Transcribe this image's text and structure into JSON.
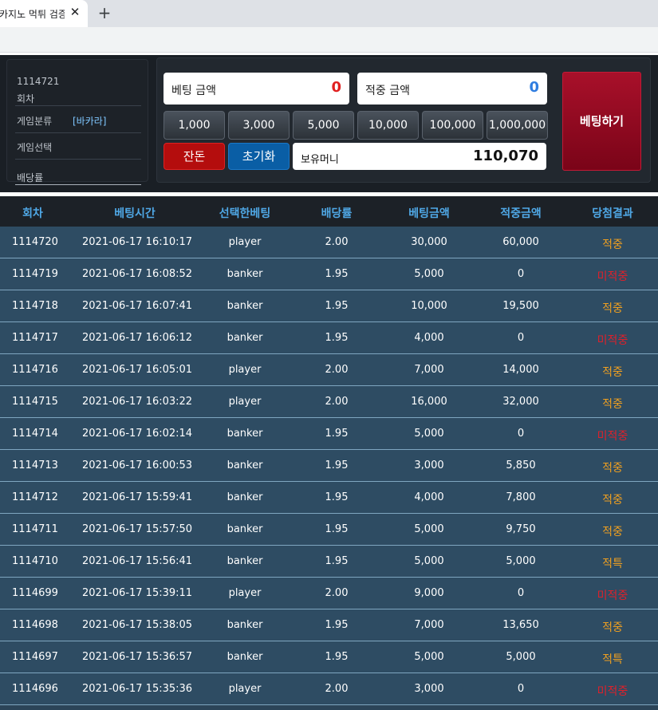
{
  "browser": {
    "tab_title": "카지노 먹튀 검증",
    "close_glyph": "✕",
    "new_tab_glyph": "+"
  },
  "info": {
    "round_number": "1114721",
    "round_label": "회차",
    "category_label": "게임분류",
    "category_value": "[바카라]",
    "select_label": "게임선택",
    "rate_label": "배당률"
  },
  "bet": {
    "bet_amount_label": "베팅 금액",
    "bet_amount_value": "0",
    "win_amount_label": "적중 금액",
    "win_amount_value": "0",
    "chips": [
      "1,000",
      "3,000",
      "5,000",
      "10,000",
      "100,000",
      "1,000,000"
    ],
    "allin_label": "잔돈",
    "reset_label": "초기화",
    "balance_label": "보유머니",
    "balance_value": "110,070",
    "bet_button_label": "베팅하기"
  },
  "table": {
    "headers": [
      "회차",
      "베팅시간",
      "선택한베팅",
      "배당률",
      "베팅금액",
      "적중금액",
      "당첨결과"
    ],
    "rows": [
      {
        "id": "1114720",
        "time": "2021-06-17 16:10:17",
        "pick": "player",
        "rate": "2.00",
        "bet": "30,000",
        "win": "60,000",
        "result": "적중",
        "status": "hit"
      },
      {
        "id": "1114719",
        "time": "2021-06-17 16:08:52",
        "pick": "banker",
        "rate": "1.95",
        "bet": "5,000",
        "win": "0",
        "result": "미적중",
        "status": "miss"
      },
      {
        "id": "1114718",
        "time": "2021-06-17 16:07:41",
        "pick": "banker",
        "rate": "1.95",
        "bet": "10,000",
        "win": "19,500",
        "result": "적중",
        "status": "hit"
      },
      {
        "id": "1114717",
        "time": "2021-06-17 16:06:12",
        "pick": "banker",
        "rate": "1.95",
        "bet": "4,000",
        "win": "0",
        "result": "미적중",
        "status": "miss"
      },
      {
        "id": "1114716",
        "time": "2021-06-17 16:05:01",
        "pick": "player",
        "rate": "2.00",
        "bet": "7,000",
        "win": "14,000",
        "result": "적중",
        "status": "hit"
      },
      {
        "id": "1114715",
        "time": "2021-06-17 16:03:22",
        "pick": "player",
        "rate": "2.00",
        "bet": "16,000",
        "win": "32,000",
        "result": "적중",
        "status": "hit"
      },
      {
        "id": "1114714",
        "time": "2021-06-17 16:02:14",
        "pick": "banker",
        "rate": "1.95",
        "bet": "5,000",
        "win": "0",
        "result": "미적중",
        "status": "miss"
      },
      {
        "id": "1114713",
        "time": "2021-06-17 16:00:53",
        "pick": "banker",
        "rate": "1.95",
        "bet": "3,000",
        "win": "5,850",
        "result": "적중",
        "status": "hit"
      },
      {
        "id": "1114712",
        "time": "2021-06-17 15:59:41",
        "pick": "banker",
        "rate": "1.95",
        "bet": "4,000",
        "win": "7,800",
        "result": "적중",
        "status": "hit"
      },
      {
        "id": "1114711",
        "time": "2021-06-17 15:57:50",
        "pick": "banker",
        "rate": "1.95",
        "bet": "5,000",
        "win": "9,750",
        "result": "적중",
        "status": "hit"
      },
      {
        "id": "1114710",
        "time": "2021-06-17 15:56:41",
        "pick": "banker",
        "rate": "1.95",
        "bet": "5,000",
        "win": "5,000",
        "result": "적특",
        "status": "hit"
      },
      {
        "id": "1114699",
        "time": "2021-06-17 15:39:11",
        "pick": "player",
        "rate": "2.00",
        "bet": "9,000",
        "win": "0",
        "result": "미적중",
        "status": "miss"
      },
      {
        "id": "1114698",
        "time": "2021-06-17 15:38:05",
        "pick": "banker",
        "rate": "1.95",
        "bet": "7,000",
        "win": "13,650",
        "result": "적중",
        "status": "hit"
      },
      {
        "id": "1114697",
        "time": "2021-06-17 15:36:57",
        "pick": "banker",
        "rate": "1.95",
        "bet": "5,000",
        "win": "5,000",
        "result": "적특",
        "status": "hit"
      },
      {
        "id": "1114696",
        "time": "2021-06-17 15:35:36",
        "pick": "player",
        "rate": "2.00",
        "bet": "3,000",
        "win": "0",
        "result": "미적중",
        "status": "miss"
      }
    ]
  },
  "colors": {
    "hit": "#f0a020",
    "miss": "#e0202a",
    "header_text": "#4fa8e6",
    "row_bg": "#2e4c63"
  }
}
